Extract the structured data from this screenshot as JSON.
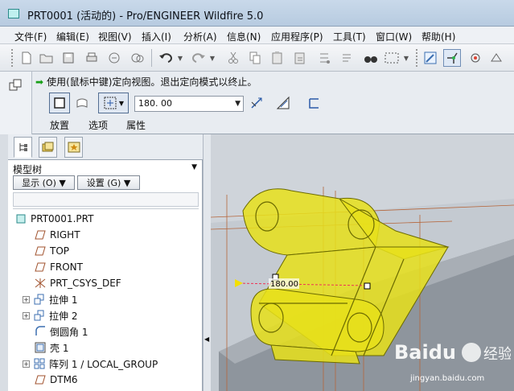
{
  "window": {
    "title": "PRT0001 (活动的) - Pro/ENGINEER Wildfire 5.0"
  },
  "menubar": [
    "文件(F)",
    "编辑(E)",
    "视图(V)",
    "插入(I)",
    "分析(A)",
    "信息(N)",
    "应用程序(P)",
    "工具(T)",
    "窗口(W)",
    "帮助(H)"
  ],
  "message": {
    "text": "使用(鼠标中键)定向视图。退出定向模式以终止。"
  },
  "dashboard": {
    "angle_value": "180. 00",
    "tabs": [
      "放置",
      "选项",
      "属性"
    ]
  },
  "model_tree": {
    "title": "模型树",
    "show_button": "显示 (O) ▼",
    "settings_button": "设置 (G) ▼",
    "nodes": [
      {
        "label": "PRT0001.PRT",
        "icon": "part-icon"
      },
      {
        "label": "RIGHT",
        "icon": "datum-plane-icon"
      },
      {
        "label": "TOP",
        "icon": "datum-plane-icon"
      },
      {
        "label": "FRONT",
        "icon": "datum-plane-icon"
      },
      {
        "label": "PRT_CSYS_DEF",
        "icon": "csys-icon"
      },
      {
        "label": "拉伸 1",
        "icon": "extrude-icon"
      },
      {
        "label": "拉伸 2",
        "icon": "extrude-icon"
      },
      {
        "label": "倒圆角 1",
        "icon": "round-icon"
      },
      {
        "label": "壳 1",
        "icon": "shell-icon"
      },
      {
        "label": "阵列 1 / LOCAL_GROUP",
        "icon": "pattern-icon"
      },
      {
        "label": "DTM6",
        "icon": "datum-plane-icon"
      }
    ]
  },
  "viewport": {
    "dimension_label": "180.00",
    "colors": {
      "model_fill": "#e8e01a",
      "model_edge": "#6b6a00",
      "background": "#c4cad1"
    }
  },
  "watermark": {
    "text": "jingyan.baidu.com"
  }
}
